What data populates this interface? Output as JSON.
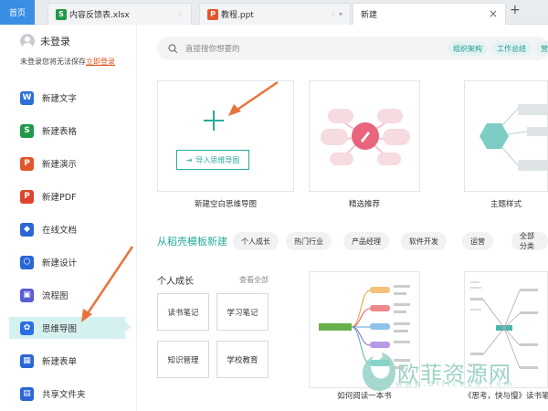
{
  "tabs": {
    "home": "首页",
    "file1": "内容反馈表.xlsx",
    "file2": "教程.ppt",
    "active": "新建",
    "close": "×",
    "add": "+"
  },
  "user": {
    "name": "未登录",
    "hint": "未登录您将无法保存",
    "login_link": "立即登录"
  },
  "sidebar": {
    "items": [
      {
        "label": "新建文字",
        "icon": "W",
        "color": "#2b6fd6"
      },
      {
        "label": "新建表格",
        "icon": "S",
        "color": "#1e9a4a"
      },
      {
        "label": "新建演示",
        "icon": "P",
        "color": "#e0572c"
      },
      {
        "label": "新建PDF",
        "icon": "P",
        "color": "#e0452c"
      },
      {
        "label": "在线文档",
        "icon": "◆",
        "color": "#2a66d6"
      },
      {
        "label": "新建设计",
        "icon": "⬡",
        "color": "#2a66d6"
      },
      {
        "label": "流程图",
        "icon": "▣",
        "color": "#5a5cd6"
      },
      {
        "label": "思维导图",
        "icon": "✿",
        "color": "#2a6ee6"
      },
      {
        "label": "新建表单",
        "icon": "▦",
        "color": "#2a66d6"
      },
      {
        "label": "共享文件夹",
        "icon": "▤",
        "color": "#2a66d6"
      }
    ]
  },
  "search": {
    "placeholder": "直接搜你想要的",
    "tags": [
      "组织架构",
      "工作总结",
      "营"
    ]
  },
  "top_cards": [
    {
      "label": "新建空白思维导图"
    },
    {
      "label": "精选推荐"
    },
    {
      "label": "主题样式"
    }
  ],
  "import_button": "导入思维导图",
  "template_section": {
    "title": "从稻壳模板新建",
    "chips": [
      "个人成长",
      "热门行业",
      "产品经理",
      "软件开发",
      "运营",
      "全部分类"
    ]
  },
  "growth": {
    "title": "个人成长",
    "view_all": "查看全部",
    "items": [
      "读书笔记",
      "学习笔记",
      "知识管理",
      "学校教育"
    ]
  },
  "templates": [
    {
      "label": "如何阅读一本书"
    },
    {
      "label": "《思考，快与慢》读书笔记"
    }
  ],
  "watermark": {
    "text": "欧菲资源网",
    "url": "www.office26.com"
  },
  "accent_color": "#28aa9c",
  "arrow_color": "#e8743b"
}
